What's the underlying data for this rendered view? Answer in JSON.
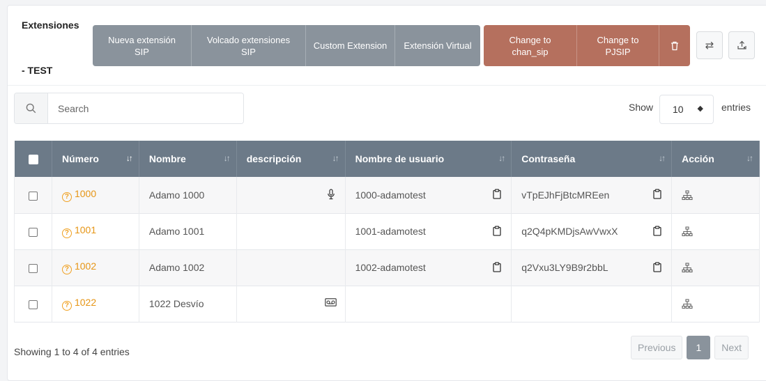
{
  "header": {
    "title": "Extensiones",
    "subtitle": "- TEST"
  },
  "actions": {
    "new_sip": "Nueva extensión SIP",
    "dump_sip": "Volcado extensiones SIP",
    "custom": "Custom Extension",
    "virtual": "Extensión Virtual",
    "to_chan_sip": "Change to chan_sip",
    "to_pjsip": "Change to PJSIP"
  },
  "search": {
    "placeholder": "Search"
  },
  "length": {
    "show_label": "Show",
    "value": "10",
    "entries_label": "entries"
  },
  "table": {
    "columns": [
      "Número",
      "Nombre",
      "descripción",
      "Nombre de usuario",
      "Contraseña",
      "Acción"
    ],
    "rows": [
      {
        "numero": "1000",
        "nombre": "Adamo 1000",
        "descripcion_icon": "microphone-icon",
        "usuario": "1000-adamotest",
        "password": "vTpEJhFjBtcMREen"
      },
      {
        "numero": "1001",
        "nombre": "Adamo 1001",
        "descripcion_icon": "",
        "usuario": "1001-adamotest",
        "password": "q2Q4pKMDjsAwVwxX"
      },
      {
        "numero": "1002",
        "nombre": "Adamo 1002",
        "descripcion_icon": "",
        "usuario": "1002-adamotest",
        "password": "q2Vxu3LY9B9r2bbL"
      },
      {
        "numero": "1022",
        "nombre": "1022 Desvío",
        "descripcion_icon": "voicemail-icon",
        "usuario": "",
        "password": ""
      }
    ]
  },
  "footer": {
    "info": "Showing 1 to 4 of 4 entries",
    "prev": "Previous",
    "page": "1",
    "next": "Next"
  },
  "colors": {
    "gray_button": "#8a939c",
    "red_button": "#b5705e",
    "table_header": "#6c7a88",
    "number_accent": "#e69515"
  }
}
